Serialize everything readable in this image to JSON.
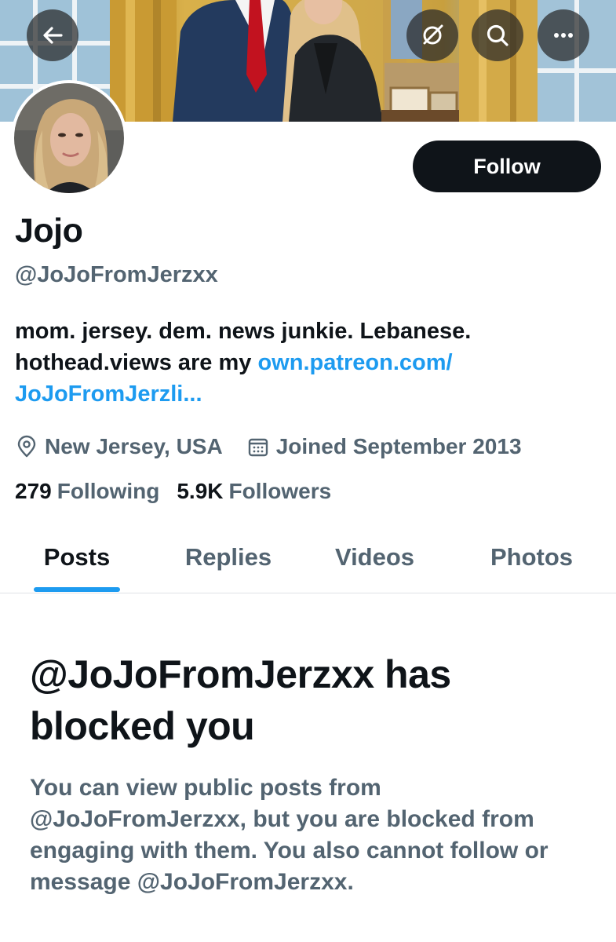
{
  "header": {
    "back_icon": "arrow-left-icon",
    "grok_icon": "grok-icon",
    "search_icon": "search-icon",
    "more_icon": "more-dots-icon"
  },
  "profile": {
    "display_name": "Jojo",
    "handle": "@JoJoFromJerzxx",
    "follow_label": "Follow",
    "bio_text": "mom. jersey. dem. news junkie. Lebanese. hothead.views are my ",
    "bio_link": "own.patreon.com/ JoJoFromJerzli...",
    "location": "New Jersey, USA",
    "location_icon": "location-pin-icon",
    "joined": "Joined September 2013",
    "joined_icon": "calendar-icon",
    "following_count": "279",
    "following_label": "Following",
    "followers_count": "5.9K",
    "followers_label": "Followers"
  },
  "tabs": [
    {
      "label": "Posts",
      "active": true
    },
    {
      "label": "Replies",
      "active": false
    },
    {
      "label": "Videos",
      "active": false
    },
    {
      "label": "Photos",
      "active": false
    }
  ],
  "blocked": {
    "title": "@JoJoFromJerzxx has blocked you",
    "body": "You can view public posts from @JoJoFromJerzxx, but you are blocked from engaging with them. You also cannot follow or message @JoJoFromJerzxx."
  },
  "colors": {
    "text": "#0f1419",
    "secondary": "#536471",
    "accent": "#1d9bf0",
    "button": "#0f1419"
  }
}
